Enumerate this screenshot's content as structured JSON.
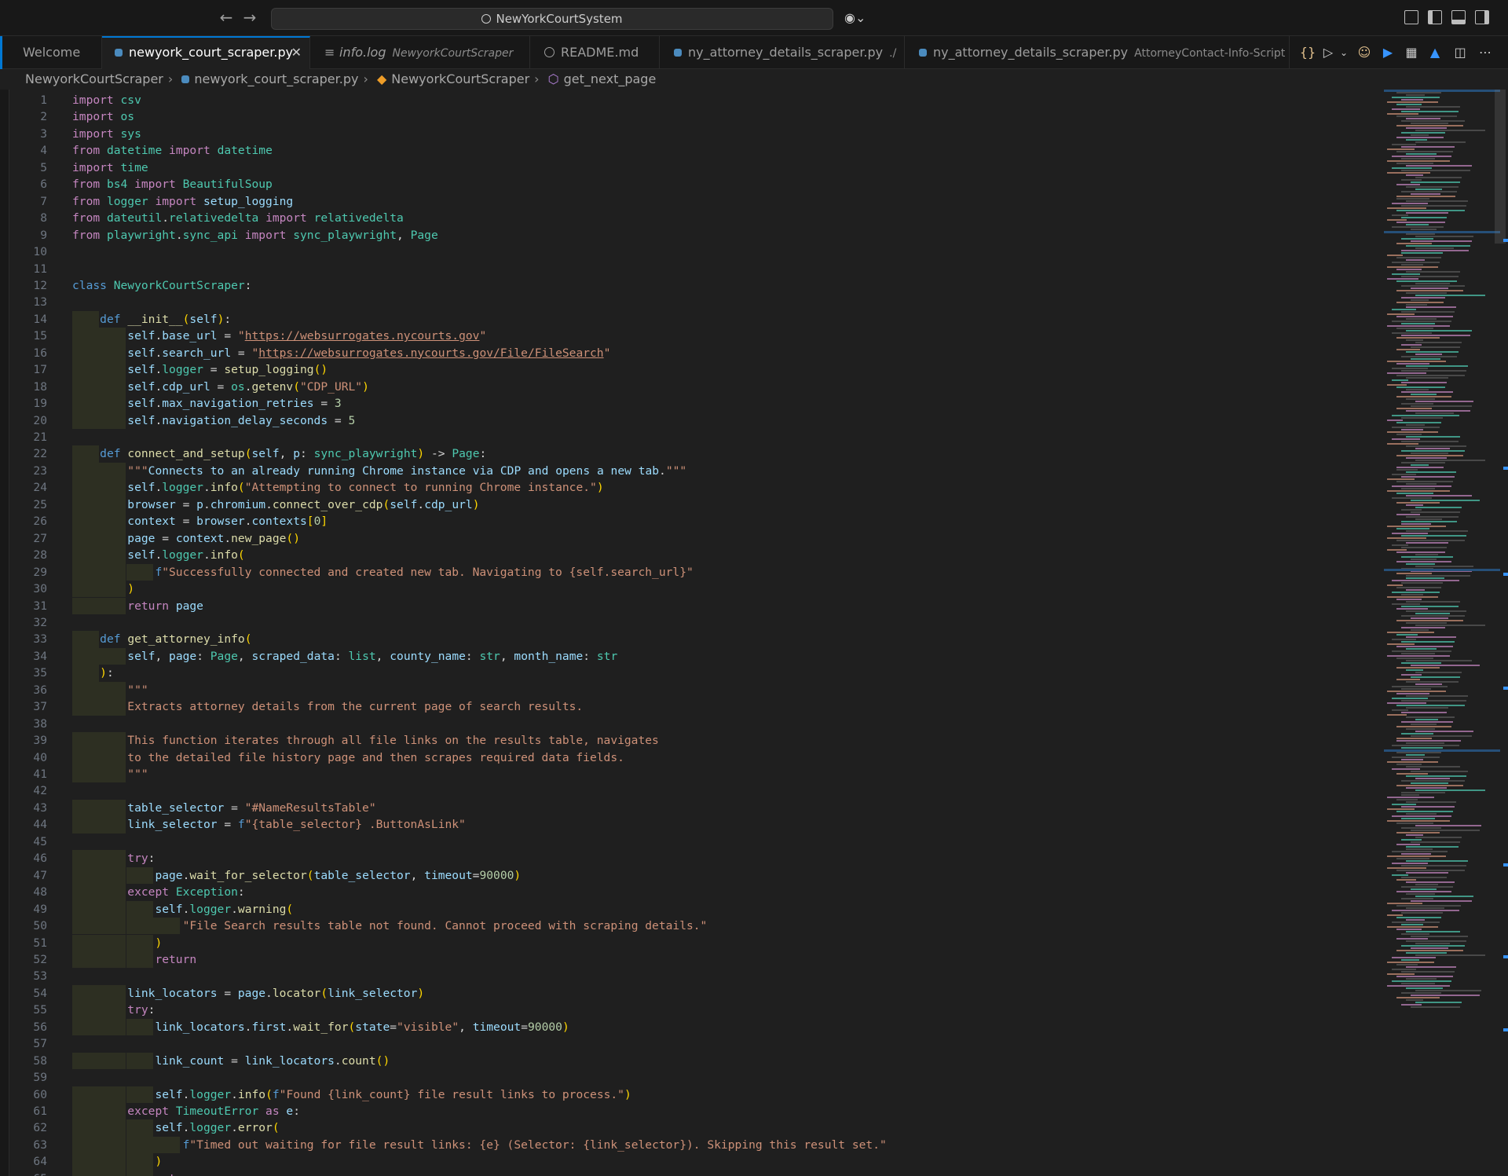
{
  "titlebar": {
    "search_text": "NewYorkCourtSystem",
    "back_icon": "arrow-left-icon",
    "forward_icon": "arrow-right-icon"
  },
  "tabs": [
    {
      "label": "Welcome",
      "desc": ""
    },
    {
      "label": "newyork_court_scraper.py",
      "desc": "",
      "active": true
    },
    {
      "label": "info.log",
      "desc": "NewyorkCourtScraper"
    },
    {
      "label": "README.md",
      "desc": ""
    },
    {
      "label": "ny_attorney_details_scraper.py",
      "desc": "./"
    },
    {
      "label": "ny_attorney_details_scraper.py",
      "desc": "AttorneyContact-Info-Script"
    }
  ],
  "breadcrumb": {
    "folder": "NewyorkCourtScraper",
    "file": "newyork_court_scraper.py",
    "class": "NewyorkCourtScraper",
    "method": "get_next_page"
  },
  "code_lines": [
    "import csv",
    "import os",
    "import sys",
    "from datetime import datetime",
    "import time",
    "from bs4 import BeautifulSoup",
    "from logger import setup_logging",
    "from dateutil.relativedelta import relativedelta",
    "from playwright.sync_api import sync_playwright, Page",
    "",
    "",
    "class NewyorkCourtScraper:",
    "",
    "    def __init__(self):",
    "        self.base_url = \"https://websurrogates.nycourts.gov\"",
    "        self.search_url = \"https://websurrogates.nycourts.gov/File/FileSearch\"",
    "        self.logger = setup_logging()",
    "        self.cdp_url = os.getenv(\"CDP_URL\")",
    "        self.max_navigation_retries = 3",
    "        self.navigation_delay_seconds = 5",
    "",
    "    def connect_and_setup(self, p: sync_playwright) -> Page:",
    "        \"\"\"Connects to an already running Chrome instance via CDP and opens a new tab.\"\"\"",
    "        self.logger.info(\"Attempting to connect to running Chrome instance.\")",
    "        browser = p.chromium.connect_over_cdp(self.cdp_url)",
    "        context = browser.contexts[0]",
    "        page = context.new_page()",
    "        self.logger.info(",
    "            f\"Successfully connected and created new tab. Navigating to {self.search_url}\"",
    "        )",
    "        return page",
    "",
    "    def get_attorney_info(",
    "        self, page: Page, scraped_data: list, county_name: str, month_name: str",
    "    ):",
    "        \"\"\"",
    "        Extracts attorney details from the current page of search results.",
    "",
    "        This function iterates through all file links on the results table, navigates",
    "        to the detailed file history page and then scrapes required data fields.",
    "        \"\"\"",
    "",
    "        table_selector = \"#NameResultsTable\"",
    "        link_selector = f\"{table_selector} .ButtonAsLink\"",
    "",
    "        try:",
    "            page.wait_for_selector(table_selector, timeout=90000)",
    "        except Exception:",
    "            self.logger.warning(",
    "                \"File Search results table not found. Cannot proceed with scraping details.\"",
    "            )",
    "            return",
    "",
    "        link_locators = page.locator(link_selector)",
    "        try:",
    "            link_locators.first.wait_for(state=\"visible\", timeout=90000)",
    "",
    "            link_count = link_locators.count()",
    "",
    "            self.logger.info(f\"Found {link_count} file result links to process.\")",
    "        except TimeoutError as e:",
    "            self.logger.error(",
    "                f\"Timed out waiting for file result links: {e} (Selector: {link_selector}). Skipping this result set.\"",
    "            )",
    "            return"
  ]
}
